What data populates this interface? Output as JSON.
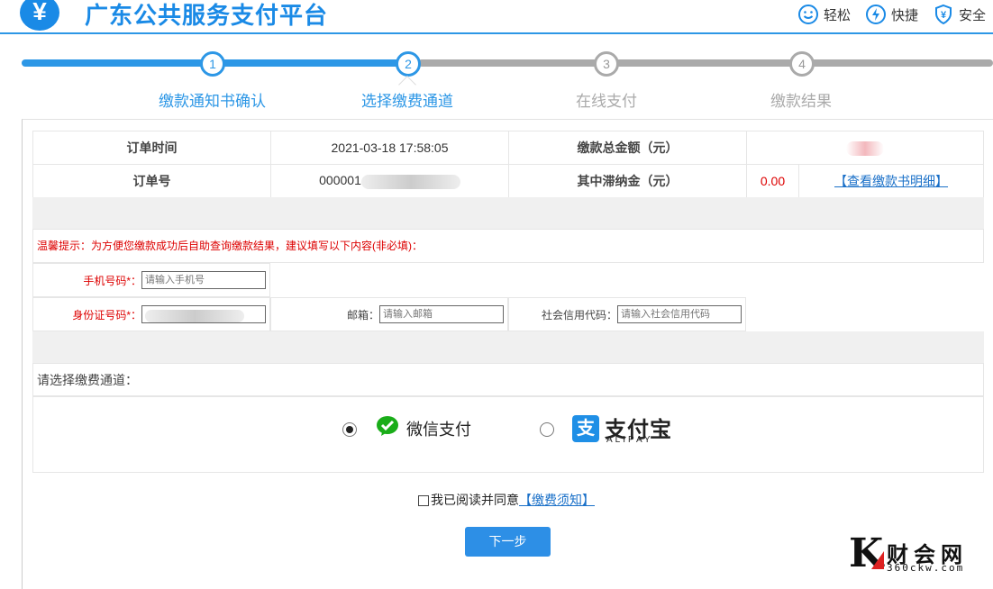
{
  "header": {
    "logo_glyph": "¥",
    "title": "广东公共服务支付平台",
    "badges": [
      {
        "icon": "smile-icon",
        "label": "轻松"
      },
      {
        "icon": "lightning-icon",
        "label": "快捷"
      },
      {
        "icon": "shield-yen-icon",
        "label": "安全"
      }
    ],
    "accent_color": "#1a8ae6"
  },
  "progress": {
    "steps": [
      {
        "num": "1",
        "label": "缴款通知书确认"
      },
      {
        "num": "2",
        "label": "选择缴费通道"
      },
      {
        "num": "3",
        "label": "在线支付"
      },
      {
        "num": "4",
        "label": "缴款结果"
      }
    ],
    "current_step": 2
  },
  "order": {
    "time_label": "订单时间",
    "time_value": "2021-03-18 17:58:05",
    "total_label": "缴款总金额（元）",
    "total_value": "",
    "no_label": "订单号",
    "no_value": "000001",
    "late_fee_label": "其中滞纳金（元）",
    "late_fee_value": "0.00",
    "detail_link": "【查看缴款书明细】"
  },
  "tip": "温馨提示：为方便您缴款成功后自助查询缴款结果，建议填写以下内容(非必填)：",
  "fields": {
    "phone_label": "手机号码*：",
    "phone_placeholder": "请输入手机号",
    "id_label": "身份证号码*：",
    "email_label": "邮箱：",
    "email_placeholder": "请输入邮箱",
    "credit_label": "社会信用代码：",
    "credit_placeholder": "请输入社会信用代码"
  },
  "channel": {
    "prompt": "请选择缴费通道：",
    "wechat_label": "微信支付",
    "alipay_cn": "支付宝",
    "alipay_en": "ALIPAY",
    "selected": "wechat"
  },
  "agree": {
    "text": "我已阅读并同意",
    "link": "【缴费须知】"
  },
  "next_button": "下一步",
  "watermark": {
    "letter": "K",
    "name": "财会网",
    "url": "360ckw.com"
  }
}
